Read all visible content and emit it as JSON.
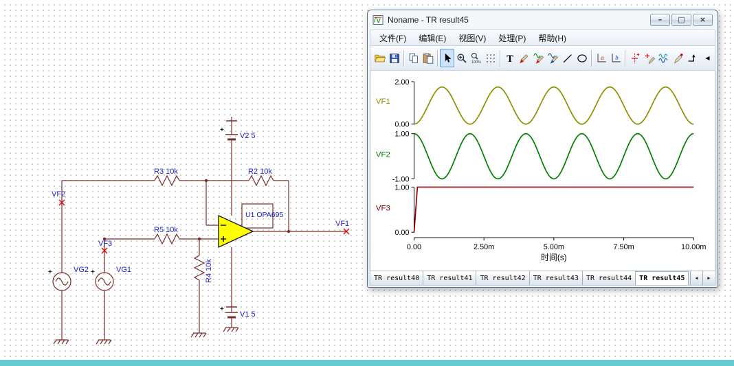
{
  "desktop": {
    "bottom_strip_color": "#66cbd0"
  },
  "schematic": {
    "colors": {
      "wire": "#7c2b2b",
      "label": "#2121cd",
      "probe": "#dd1111",
      "opamp_fill": "#ffff00"
    },
    "labels": {
      "v2": "V2 5",
      "v1": "V1 5",
      "r3": "R3 10k",
      "r2": "R2 10k",
      "r5": "R5 10k",
      "r4": "R4 10k",
      "u1": "U1 OPA695",
      "vf1": "VF1",
      "vf2": "VF2",
      "vf3": "VF3",
      "vg1": "VG1",
      "vg2": "VG2",
      "plus": "+",
      "minus_sign": "-"
    }
  },
  "window": {
    "title": "Noname - TR result45",
    "controls": [
      {
        "name": "minimize-button",
        "glyph": "–"
      },
      {
        "name": "maximize-button",
        "glyph": "□"
      },
      {
        "name": "close-button",
        "glyph": "×"
      }
    ]
  },
  "menu": {
    "items": [
      {
        "id": "file",
        "label": "文件(F)"
      },
      {
        "id": "edit",
        "label": "编辑(E)"
      },
      {
        "id": "view",
        "label": "视图(V)"
      },
      {
        "id": "process",
        "label": "处理(P)"
      },
      {
        "id": "help",
        "label": "帮助(H)"
      }
    ]
  },
  "toolbar": {
    "icons": [
      "open-folder-icon",
      "save-icon",
      "copy-icon",
      "paste-icon",
      "select-cursor-icon",
      "zoom-in-icon",
      "zoom-100-icon",
      "grid-icon",
      "text-tool-icon",
      "probe-pin-icon",
      "probe-wave-icon",
      "signal-pen-icon",
      "line-tool-icon",
      "ellipse-tool-icon",
      "axis-a-icon",
      "axis-b-icon",
      "cursor-plus-icon",
      "pen-plus-icon",
      "waveforms-icon",
      "pen-icon",
      "marker-icon"
    ],
    "active_index": 4,
    "overflow_glyph": "◀"
  },
  "tabs": {
    "items": [
      "TR result40",
      "TR result41",
      "TR result42",
      "TR result43",
      "TR result44",
      "TR result45"
    ],
    "active": "TR result45",
    "scroll_left": "◀",
    "scroll_right": "▶"
  },
  "chart_data": {
    "type": "line",
    "xlabel": "时间(s)",
    "x_range": [
      0,
      0.01
    ],
    "x_tick_values": [
      0,
      0.0025,
      0.005,
      0.0075,
      0.01
    ],
    "x_ticks": [
      "0.00",
      "2.50m",
      "5.00m",
      "7.50m",
      "10.00m"
    ],
    "grid": false,
    "legend": "none",
    "subplots": [
      {
        "name": "VF1",
        "color": "#8f8f00",
        "ylim": [
          0,
          2
        ],
        "y_ticks": [
          "2.00",
          "0.00"
        ],
        "waveform": {
          "kind": "sine",
          "offset": 0.875,
          "amplitude": 0.875,
          "frequency_hz": 500,
          "phase_deg": -90
        },
        "description": "sine 0 to 1.75, 5 cycles in 10 ms, starts at 0"
      },
      {
        "name": "VF2",
        "color": "#007f00",
        "ylim": [
          -1,
          1
        ],
        "y_ticks": [
          "1.00",
          "-1.00"
        ],
        "waveform": {
          "kind": "sine",
          "offset": 0,
          "amplitude": 1,
          "frequency_hz": 500,
          "phase_deg": 90
        },
        "description": "cosine +/-1, 5 cycles in 10 ms, starts at +1"
      },
      {
        "name": "VF3",
        "color": "#8b0000",
        "ylim": [
          0,
          1
        ],
        "y_ticks": [
          "1.00",
          "0.00"
        ],
        "waveform": {
          "kind": "step",
          "initial": 0,
          "final": 1,
          "rise_time_s": 0.00012
        },
        "description": "steps from 0 to 1 near t=0 then constant"
      }
    ]
  }
}
